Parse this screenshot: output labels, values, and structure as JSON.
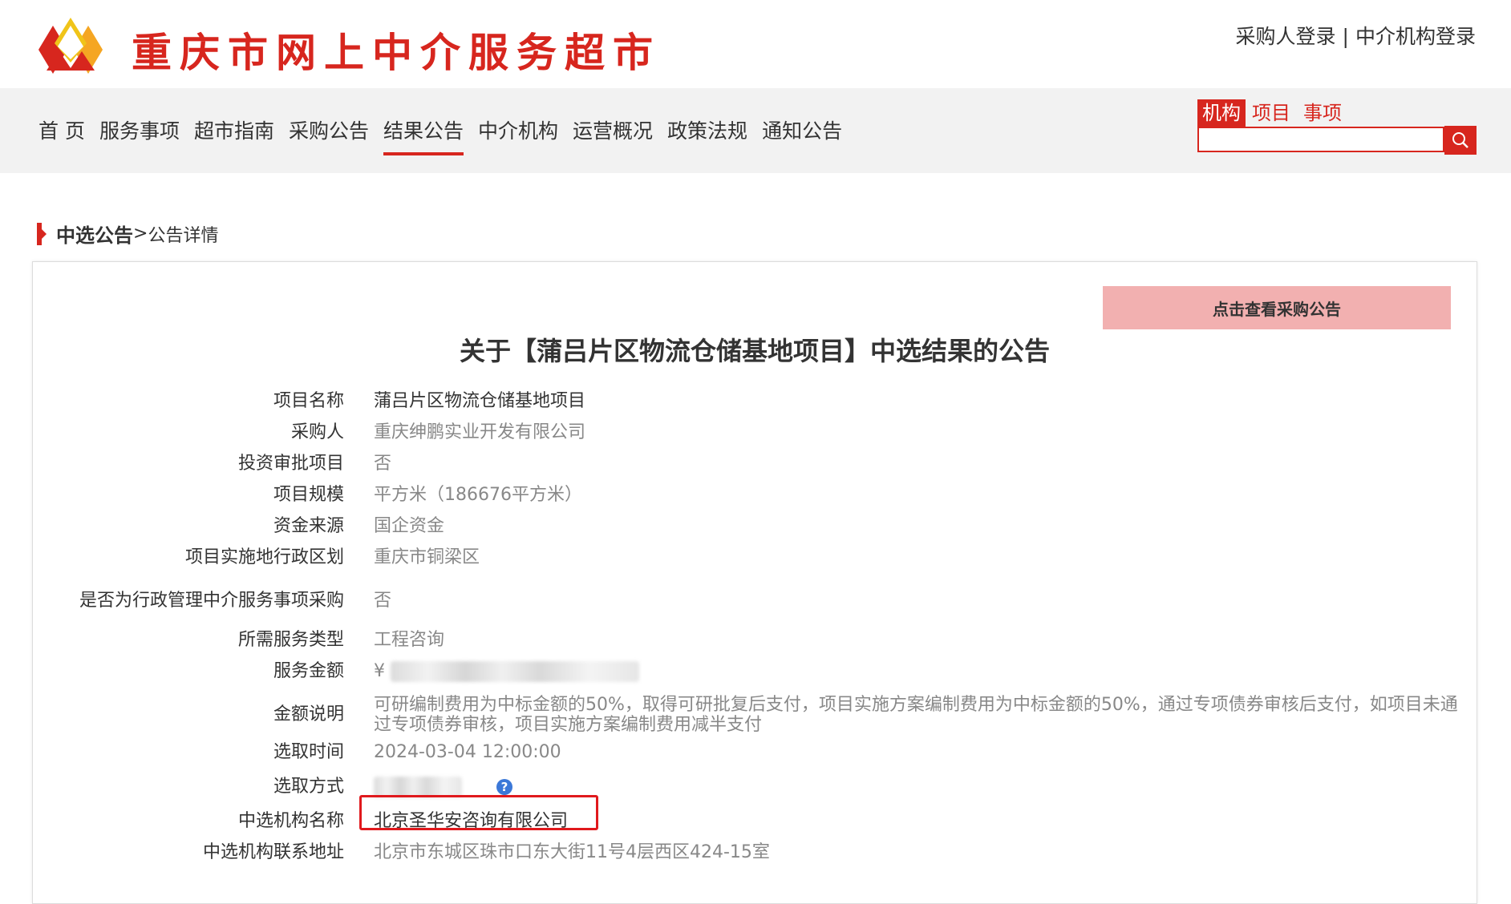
{
  "header": {
    "site_title": "重庆市网上中介服务超市",
    "buyer_login": "采购人登录",
    "separator": "|",
    "agency_login": "中介机构登录",
    "brand_color": "#d7261e"
  },
  "nav": {
    "items": [
      {
        "label": "首 页"
      },
      {
        "label": "服务事项"
      },
      {
        "label": "超市指南"
      },
      {
        "label": "采购公告"
      },
      {
        "label": "结果公告",
        "active": true
      },
      {
        "label": "中介机构"
      },
      {
        "label": "运营概况"
      },
      {
        "label": "政策法规"
      },
      {
        "label": "通知公告"
      }
    ]
  },
  "search": {
    "tabs": [
      {
        "label": "机构",
        "active": true
      },
      {
        "label": "项目"
      },
      {
        "label": "事项"
      }
    ],
    "value": "",
    "icon": "search-icon"
  },
  "breadcrumb": {
    "section": "中选公告",
    "sep": ">",
    "current": "公告详情"
  },
  "announcement": {
    "view_button": "点击查看采购公告",
    "title": "关于【蒲吕片区物流仓储基地项目】中选结果的公告",
    "fields": [
      {
        "label": "项目名称",
        "value": "蒲吕片区物流仓储基地项目"
      },
      {
        "label": "采购人",
        "value": "重庆绅鹏实业开发有限公司"
      },
      {
        "label": "投资审批项目",
        "value": "否"
      },
      {
        "label": "项目规模",
        "value": "平方米（186676平方米）"
      },
      {
        "label": "资金来源",
        "value": "国企资金"
      },
      {
        "label": "项目实施地行政区划",
        "value": "重庆市铜梁区"
      },
      {
        "label": "是否为行政管理中介服务事项采购",
        "value": "否"
      },
      {
        "label": "所需服务类型",
        "value": "工程咨询"
      },
      {
        "label": "服务金额",
        "value": "¥"
      },
      {
        "label": "金额说明",
        "value": "可研编制费用为中标金额的50%，取得可研批复后支付，项目实施方案编制费用为中标金额的50%，通过专项债券审核后支付，如项目未通过专项债券审核，项目实施方案编制费用减半支付"
      },
      {
        "label": "选取时间",
        "value": "2024-03-04 12:00:00"
      },
      {
        "label": "选取方式",
        "value": ""
      },
      {
        "label": "中选机构名称",
        "value": "北京圣华安咨询有限公司"
      },
      {
        "label": "中选机构联系地址",
        "value": "北京市东城区珠市口东大街11号4层西区424-15室"
      }
    ]
  }
}
